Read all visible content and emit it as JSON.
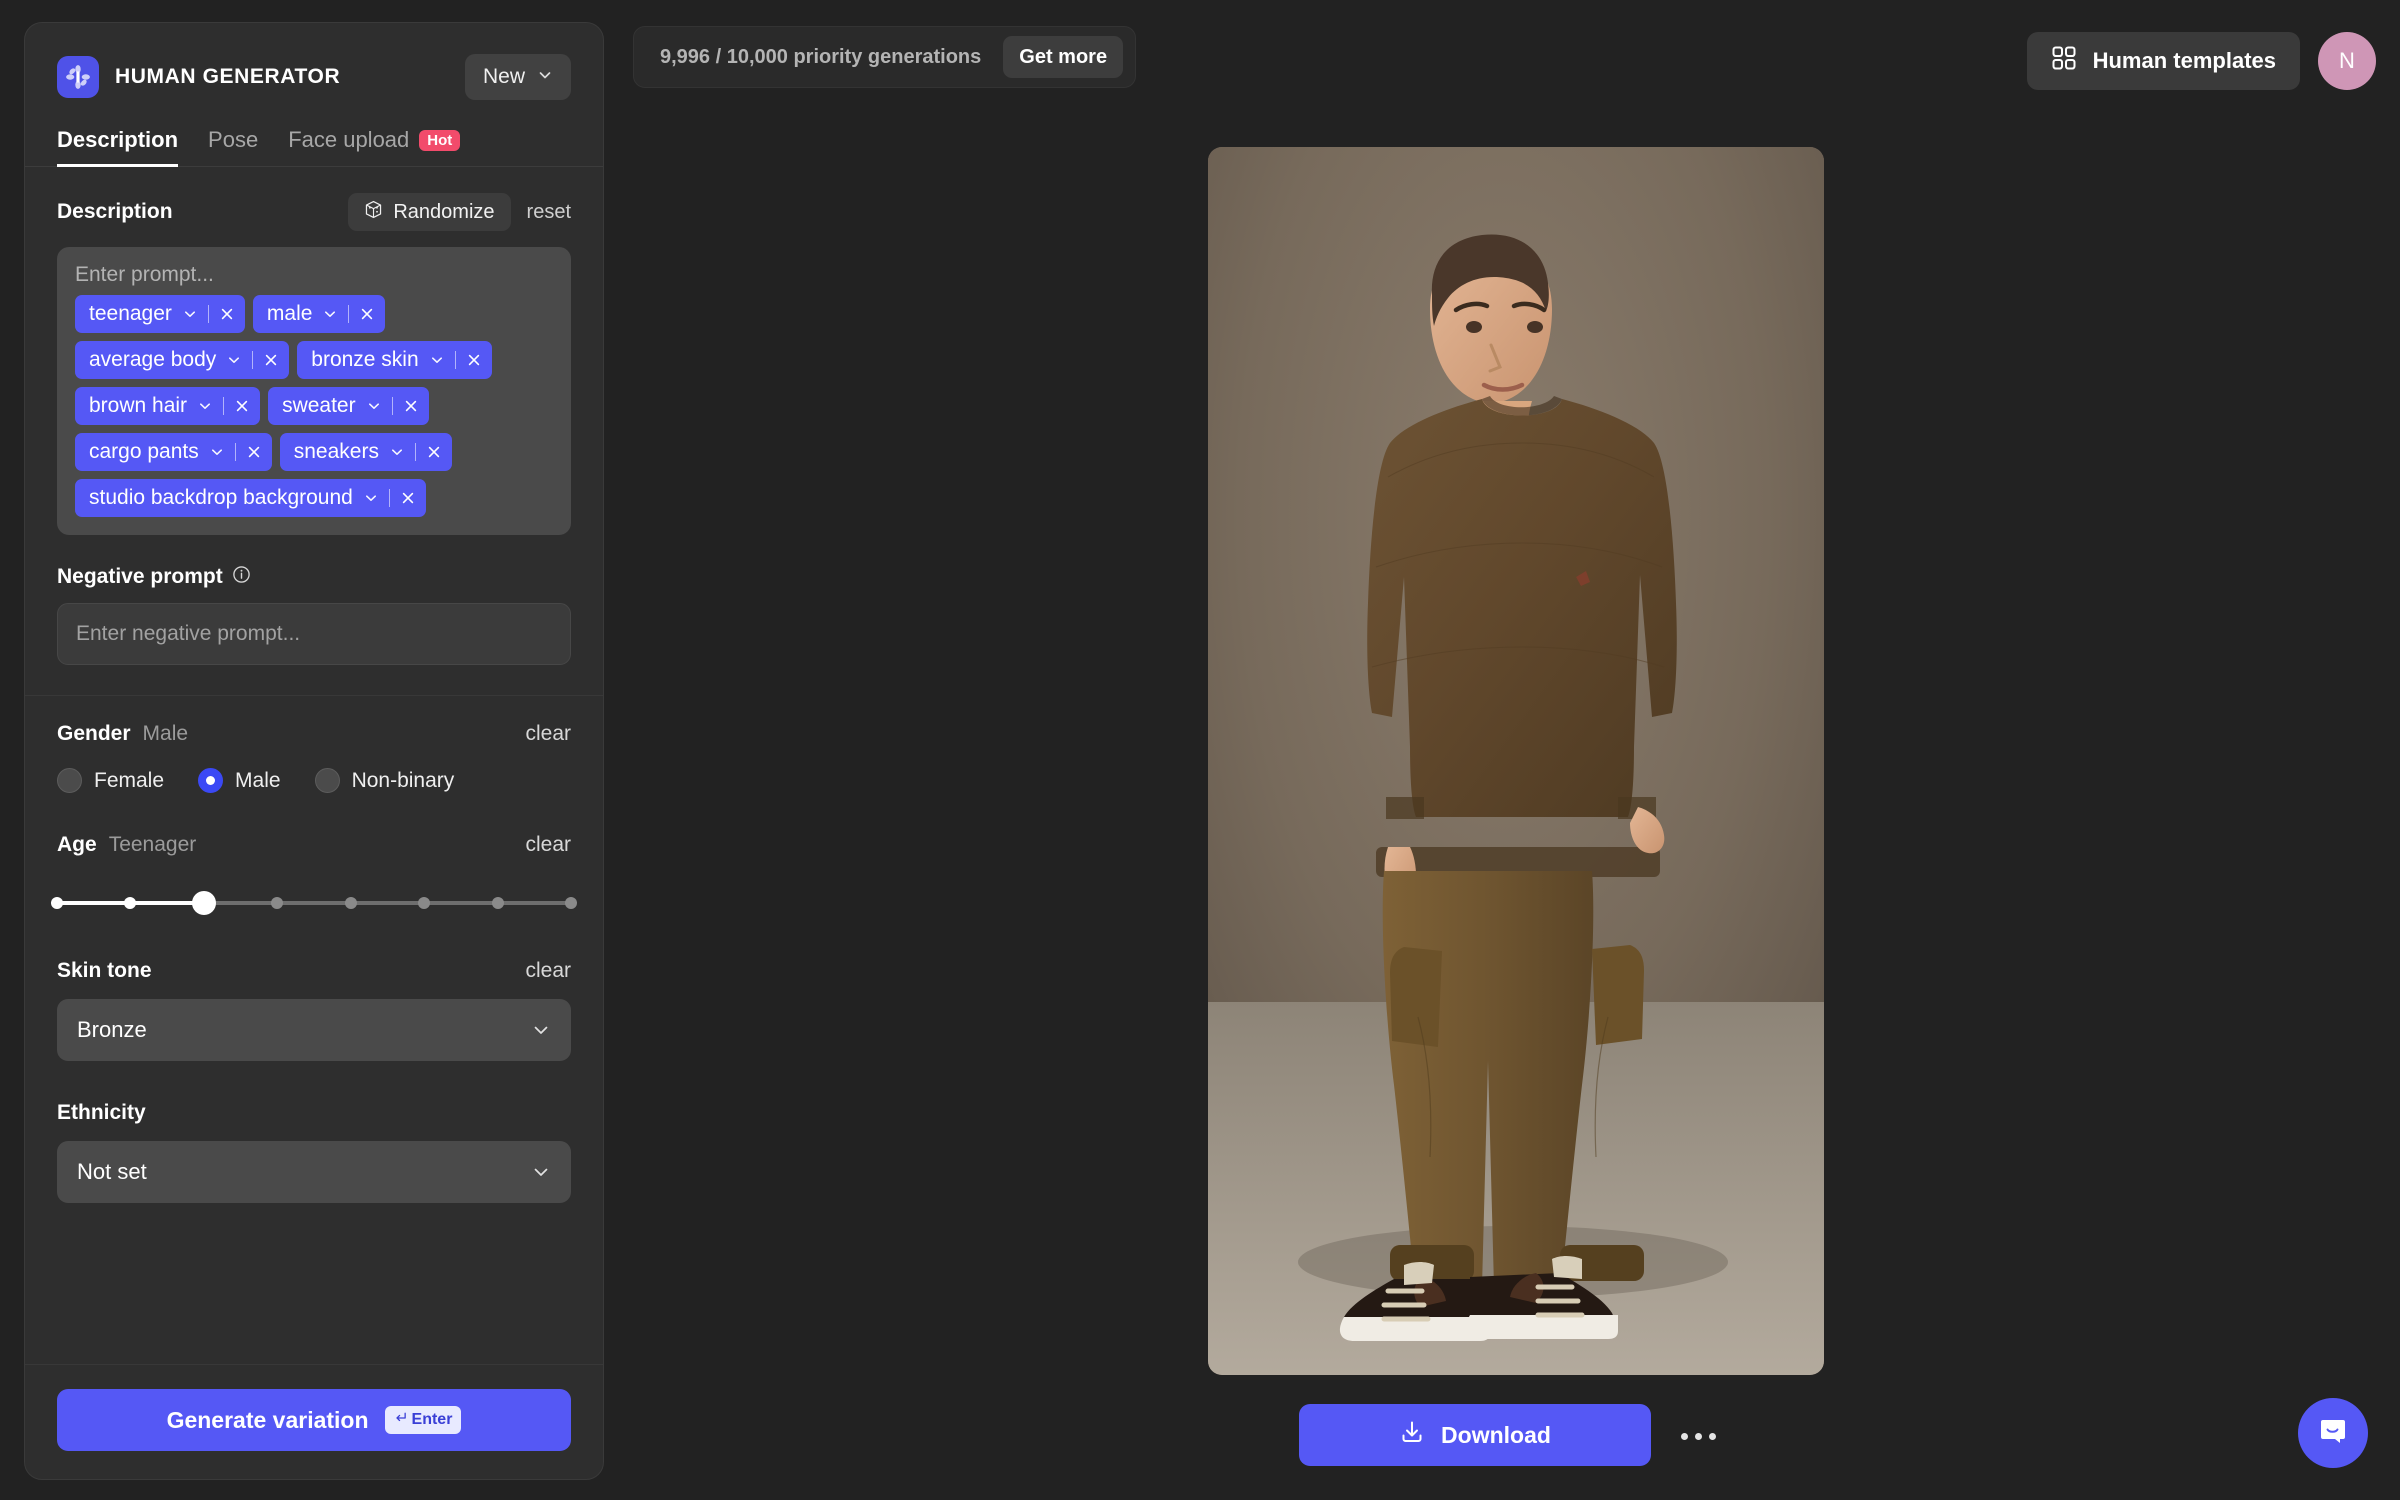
{
  "app": {
    "brand_title": "HUMAN GENERATOR",
    "logo_icon": "flower-logo-icon",
    "new_button": "New",
    "accent_color": "#5558f5",
    "panel_color": "#2e2e2e",
    "page_color": "#222222"
  },
  "tabs": [
    {
      "label": "Description",
      "active": true,
      "badge": ""
    },
    {
      "label": "Pose",
      "active": false,
      "badge": ""
    },
    {
      "label": "Face upload",
      "active": false,
      "badge": "Hot"
    }
  ],
  "description": {
    "title": "Description",
    "randomize_label": "Randomize",
    "randomize_icon": "dice-icon",
    "reset_label": "reset",
    "prompt_placeholder": "Enter prompt...",
    "tags": [
      "teenager",
      "male",
      "average body",
      "bronze skin",
      "brown hair",
      "sweater",
      "cargo pants",
      "sneakers",
      "studio backdrop background"
    ]
  },
  "negative_prompt": {
    "label": "Negative prompt",
    "info_icon": "info-icon",
    "placeholder": "Enter negative prompt..."
  },
  "gender": {
    "label": "Gender",
    "value": "Male",
    "clear_label": "clear",
    "options": [
      {
        "label": "Female",
        "selected": false
      },
      {
        "label": "Male",
        "selected": true
      },
      {
        "label": "Non-binary",
        "selected": false
      }
    ]
  },
  "age": {
    "label": "Age",
    "value": "Teenager",
    "clear_label": "clear",
    "steps": 8,
    "selected_index": 2
  },
  "skin_tone": {
    "label": "Skin tone",
    "clear_label": "clear",
    "value": "Bronze"
  },
  "ethnicity": {
    "label": "Ethnicity",
    "value": "Not set"
  },
  "generate": {
    "label": "Generate variation",
    "shortcut": "Enter",
    "shortcut_icon": "enter-arrow-icon"
  },
  "topbar": {
    "credits_text": "9,996 / 10,000 priority generations",
    "get_more_label": "Get more",
    "templates_label": "Human templates",
    "templates_icon": "grid-icon",
    "avatar_initial": "N"
  },
  "stage": {
    "download_label": "Download",
    "download_icon": "download-icon",
    "more_icon": "ellipsis-icon",
    "chat_icon": "chat-bubble-icon"
  }
}
